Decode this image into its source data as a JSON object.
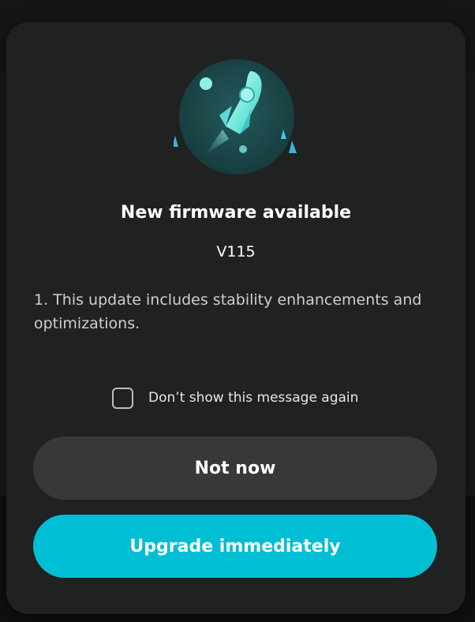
{
  "dialog": {
    "hero_icon": "rocket-icon",
    "title": "New firmware available",
    "version": "V115",
    "notes": "1. This update includes stability enhancements and optimizations.",
    "checkbox": {
      "label": "Don’t show this message again",
      "checked": false
    },
    "buttons": {
      "secondary_label": "Not now",
      "primary_label": "Upgrade immediately"
    }
  },
  "colors": {
    "dialog_bg": "#202121",
    "primary_accent": "#00bfd4",
    "secondary_button": "#383838",
    "hero_circle": "#1e4a4c"
  }
}
